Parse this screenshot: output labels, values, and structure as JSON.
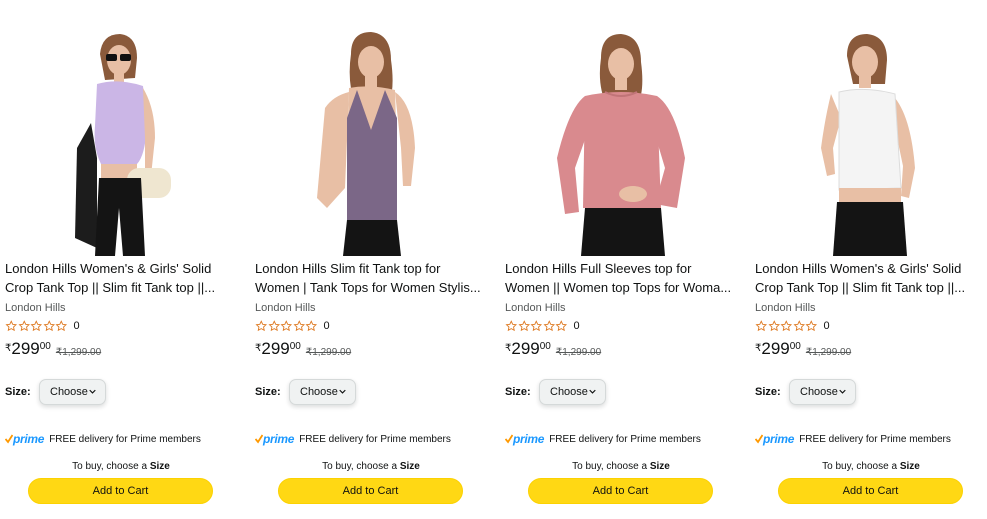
{
  "products": [
    {
      "title_line1": "London Hills Women's & Girls' Solid",
      "title_line2": "Crop Tank Top || Slim fit Tank top ||...",
      "brand": "London Hills",
      "rating_count": "0",
      "currency": "₹",
      "price_whole": "299",
      "price_fraction": "00",
      "mrp": "₹1,299.00",
      "size_label": "Size:",
      "size_select": "Choose",
      "prime_word": "prime",
      "delivery_text": "FREE delivery for Prime members",
      "hint_prefix": "To buy, choose a",
      "hint_bold": "Size",
      "add_to_cart": "Add to Cart",
      "image_icon": "model-lavender-crop-top-image",
      "garment_color": "#cbb6e6"
    },
    {
      "title_line1": "London Hills Slim fit Tank top for",
      "title_line2": "Women | Tank Tops for Women Stylis...",
      "brand": "London Hills",
      "rating_count": "0",
      "currency": "₹",
      "price_whole": "299",
      "price_fraction": "00",
      "mrp": "₹1,299.00",
      "size_label": "Size:",
      "size_select": "Choose",
      "prime_word": "prime",
      "delivery_text": "FREE delivery for Prime members",
      "hint_prefix": "To buy, choose a",
      "hint_bold": "Size",
      "add_to_cart": "Add to Cart",
      "image_icon": "model-purple-halter-top-image",
      "garment_color": "#7b6787"
    },
    {
      "title_line1": "London Hills Full Sleeves top for",
      "title_line2": "Women || Women top Tops for Woma...",
      "brand": "London Hills",
      "rating_count": "0",
      "currency": "₹",
      "price_whole": "299",
      "price_fraction": "00",
      "mrp": "₹1,299.00",
      "size_label": "Size:",
      "size_select": "Choose",
      "prime_word": "prime",
      "delivery_text": "FREE delivery for Prime members",
      "hint_prefix": "To buy, choose a",
      "hint_bold": "Size",
      "add_to_cart": "Add to Cart",
      "image_icon": "model-pink-full-sleeve-top-image",
      "garment_color": "#d98a8e"
    },
    {
      "title_line1": "London Hills Women's & Girls' Solid",
      "title_line2": "Crop Tank Top || Slim fit Tank top ||...",
      "brand": "London Hills",
      "rating_count": "0",
      "currency": "₹",
      "price_whole": "299",
      "price_fraction": "00",
      "mrp": "₹1,299.00",
      "size_label": "Size:",
      "size_select": "Choose",
      "prime_word": "prime",
      "delivery_text": "FREE delivery for Prime members",
      "hint_prefix": "To buy, choose a",
      "hint_bold": "Size",
      "add_to_cart": "Add to Cart",
      "image_icon": "model-white-crop-top-image",
      "garment_color": "#f4f4f4"
    }
  ],
  "colors": {
    "star_outline": "#de7921",
    "prime_blue": "#1a98ff",
    "prime_check": "#ff9900",
    "cart_button": "#ffd814",
    "muted_text": "#565959",
    "skin": "#e8bfa5",
    "hair": "#8a5a3b",
    "jeans": "#141414"
  }
}
